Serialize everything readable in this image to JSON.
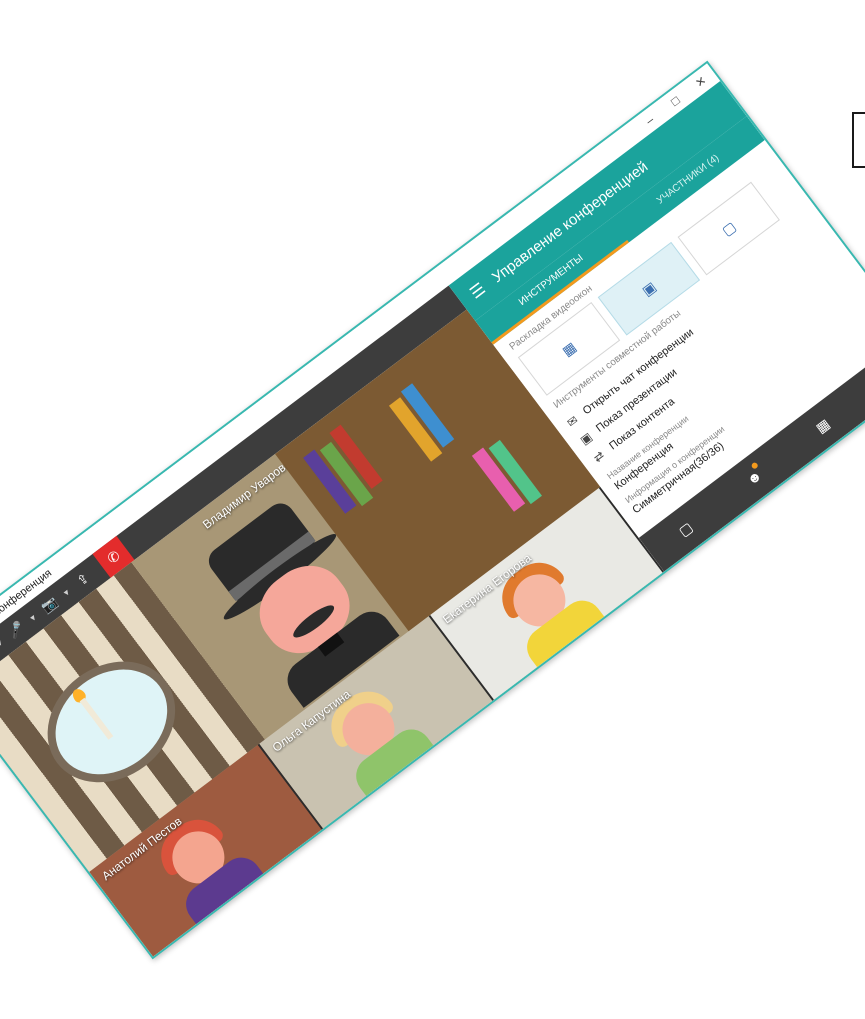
{
  "window": {
    "title": "TrueConf - Конференция",
    "controls": [
      "–",
      "□",
      "✕"
    ]
  },
  "toolbar": {
    "items": [
      {
        "icon": "star-icon",
        "glyph": "★"
      },
      {
        "icon": "speaker-icon",
        "glyph": "🔊"
      },
      {
        "icon": "microphone-icon",
        "glyph": "🎤"
      },
      {
        "icon": "camera-icon",
        "glyph": "📷"
      },
      {
        "icon": "share-screen-icon",
        "glyph": "⇪"
      }
    ],
    "hangup_glyph": "✆"
  },
  "participants": {
    "main": "Владимир Уваров",
    "thumbs": [
      {
        "name": "Анатолий Пестов"
      },
      {
        "name": "Ольга Капустина"
      },
      {
        "name": "Екатерина Егорова"
      }
    ]
  },
  "panel": {
    "title": "Управление конференцией",
    "tabs": [
      {
        "label": "ИНСТРУМЕНТЫ",
        "active": true
      },
      {
        "label": "УЧАСТНИКИ (4)",
        "active": false
      }
    ],
    "layout_label": "Раскладка видеоокон",
    "collab_label": "Инструменты совместной работы",
    "tools": [
      {
        "label": "Открыть чат конференции",
        "icon": "chat-icon",
        "glyph": "✉"
      },
      {
        "label": "Показ презентации",
        "icon": "presentation-icon",
        "glyph": "▣"
      },
      {
        "label": "Показ контента",
        "icon": "content-share-icon",
        "glyph": "⇄"
      }
    ],
    "conf_name_label": "Название конференции",
    "conf_name_value": "Конференция",
    "conf_info_label": "Информация о конференции",
    "conf_info_value": "Симметричная(36/36)"
  },
  "bottom_bar": {
    "items": [
      {
        "icon": "self-view-icon",
        "glyph": "▢"
      },
      {
        "icon": "participants-icon",
        "glyph": "☻"
      },
      {
        "icon": "layout-icon",
        "glyph": "▦"
      },
      {
        "icon": "exit-fullscreen-icon",
        "glyph": "⤢"
      }
    ]
  },
  "colors": {
    "accent": "#1ba39c",
    "tab_indicator": "#f39a1d",
    "toolbar": "#3d3d3d",
    "hangup": "#e32c2c"
  }
}
